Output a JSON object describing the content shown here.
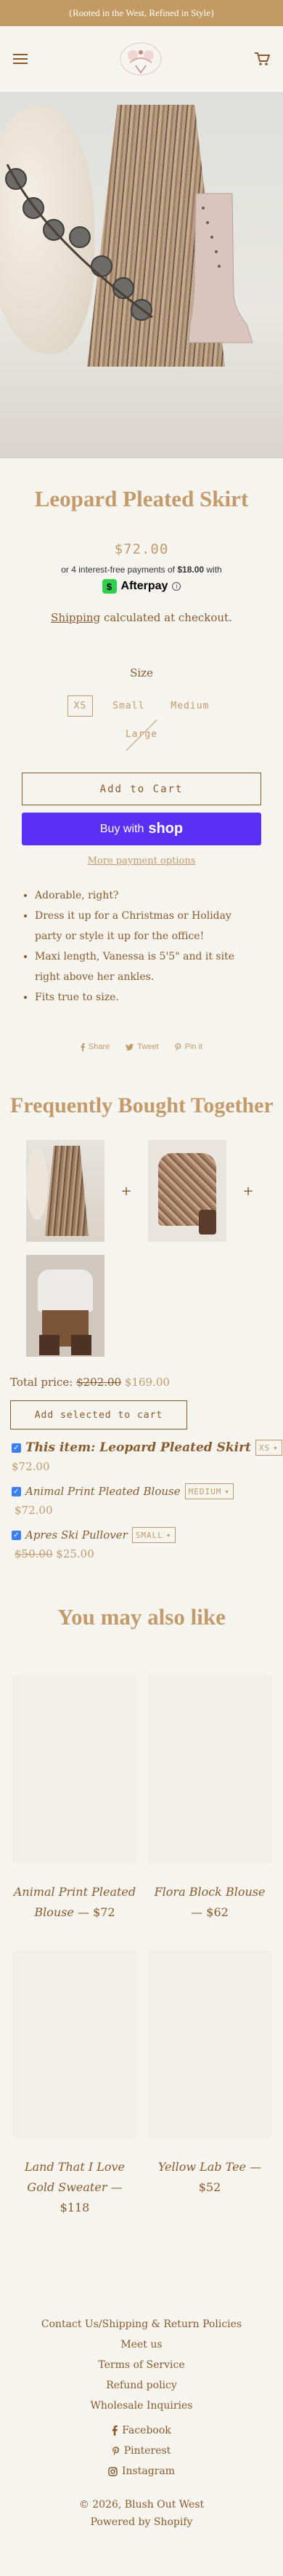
{
  "announcement": "{Rooted in the West, Refined in Style}",
  "colors": {
    "accent": "#c49a6a",
    "text": "#8b5a2b",
    "shop_pay": "#5a31f4",
    "afterpay": "#2fcf4c"
  },
  "header": {
    "menu_icon": "hamburger-icon",
    "logo": "blush-out-west-logo",
    "cart_icon": "cart-icon"
  },
  "product": {
    "title": "Leopard Pleated Skirt",
    "price": "$72.00",
    "afterpay_prefix": "or 4 interest-free payments of",
    "afterpay_amount": "$18.00",
    "afterpay_suffix": "with",
    "afterpay_brand": "Afterpay",
    "afterpay_info": "i",
    "shipping_link": "Shipping",
    "shipping_rest": "calculated at checkout.",
    "size_label": "Size",
    "sizes": [
      "XS",
      "Small",
      "Medium",
      "Large"
    ],
    "selected_size": "XS",
    "add_to_cart": "Add to Cart",
    "buy_with": "Buy with",
    "shop_brand": "shop",
    "more_payment": "More payment options",
    "description": [
      "Adorable, right?",
      "Dress it up for a Christmas or Holiday party or style it up for the office!",
      "Maxi length, Vanessa is 5'5\" and it site right above her ankles.",
      "Fits true to size."
    ],
    "share": {
      "share": "Share",
      "tweet": "Tweet",
      "pin": "Pin it"
    }
  },
  "fbt": {
    "title": "Frequently Bought Together",
    "plus": "+",
    "total_label": "Total price:",
    "total_old": "$202.00",
    "total_new": "$169.00",
    "add_selected": "Add selected to cart",
    "items": [
      {
        "name": "This item: Leopard Pleated Skirt",
        "select": "XS",
        "price": "$72.00",
        "old_price": ""
      },
      {
        "name": "Animal Print Pleated Blouse",
        "select": "MEDIUM",
        "price": "$72.00",
        "old_price": ""
      },
      {
        "name": "Apres Ski Pullover",
        "select": "SMALL",
        "price": "$25.00",
        "old_price": "$50.00"
      }
    ],
    "check": "✓",
    "caret": "▾"
  },
  "ymal": {
    "title": "You may also like",
    "products": [
      {
        "name": "Animal Print Pleated Blouse",
        "price": "$72"
      },
      {
        "name": "Flora Block Blouse",
        "price": "$62"
      },
      {
        "name": "Land That I Love Gold Sweater",
        "price": "$118"
      },
      {
        "name": "Yellow Lab Tee",
        "price": "$52"
      }
    ],
    "dash": "—"
  },
  "footer": {
    "links": [
      "Contact Us/Shipping & Return Policies",
      "Meet us",
      "Terms of Service",
      "Refund policy",
      "Wholesale Inquiries"
    ],
    "social": [
      "Facebook",
      "Pinterest",
      "Instagram"
    ],
    "copyright": "© 2026, Blush Out West",
    "powered": "Powered by Shopify"
  }
}
